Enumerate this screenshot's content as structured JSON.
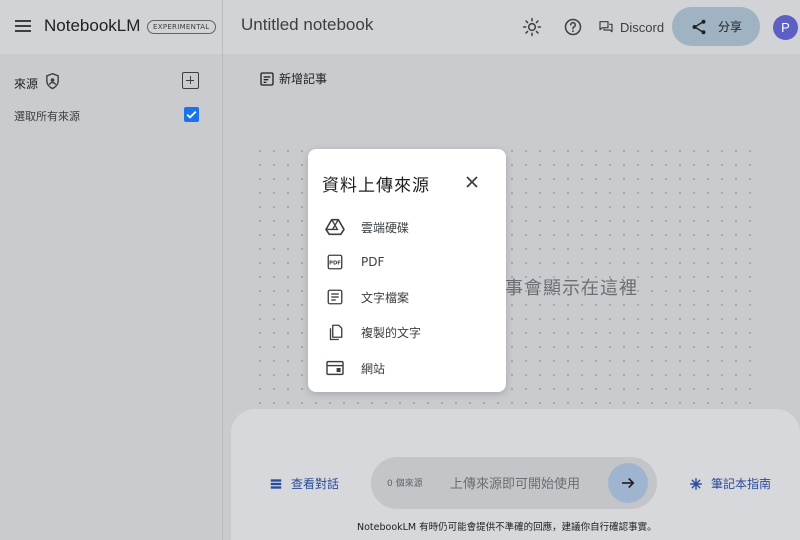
{
  "app": {
    "name": "NotebookLM",
    "badge": "EXPERIMENTAL"
  },
  "header": {
    "notebook_title": "Untitled notebook",
    "discord_label": "Discord",
    "share_label": "分享",
    "avatar_initial": "P"
  },
  "sidebar": {
    "sources_label": "來源",
    "select_all_label": "選取所有來源",
    "select_all_checked": true
  },
  "main": {
    "add_note_label": "新增記事",
    "empty_placeholder": "事會顯示在這裡"
  },
  "chat": {
    "view_chat_label": "查看對話",
    "source_count": "0 個來源",
    "input_placeholder": "上傳來源即可開始使用",
    "guide_label": "筆記本指南",
    "disclaimer": "NotebookLM 有時仍可能會提供不準確的回應，建議你自行確認事實。"
  },
  "modal": {
    "title": "資料上傳來源",
    "options": [
      {
        "label": "雲端硬碟",
        "icon": "drive-icon"
      },
      {
        "label": "PDF",
        "icon": "pdf-icon"
      },
      {
        "label": "文字檔案",
        "icon": "text-file-icon"
      },
      {
        "label": "複製的文字",
        "icon": "copy-text-icon"
      },
      {
        "label": "網站",
        "icon": "website-icon"
      }
    ]
  },
  "colors": {
    "accent": "#1a73e8",
    "share_button": "#9fb3c2",
    "avatar": "#5c5fc4",
    "link_text": "#2a4c9e"
  }
}
